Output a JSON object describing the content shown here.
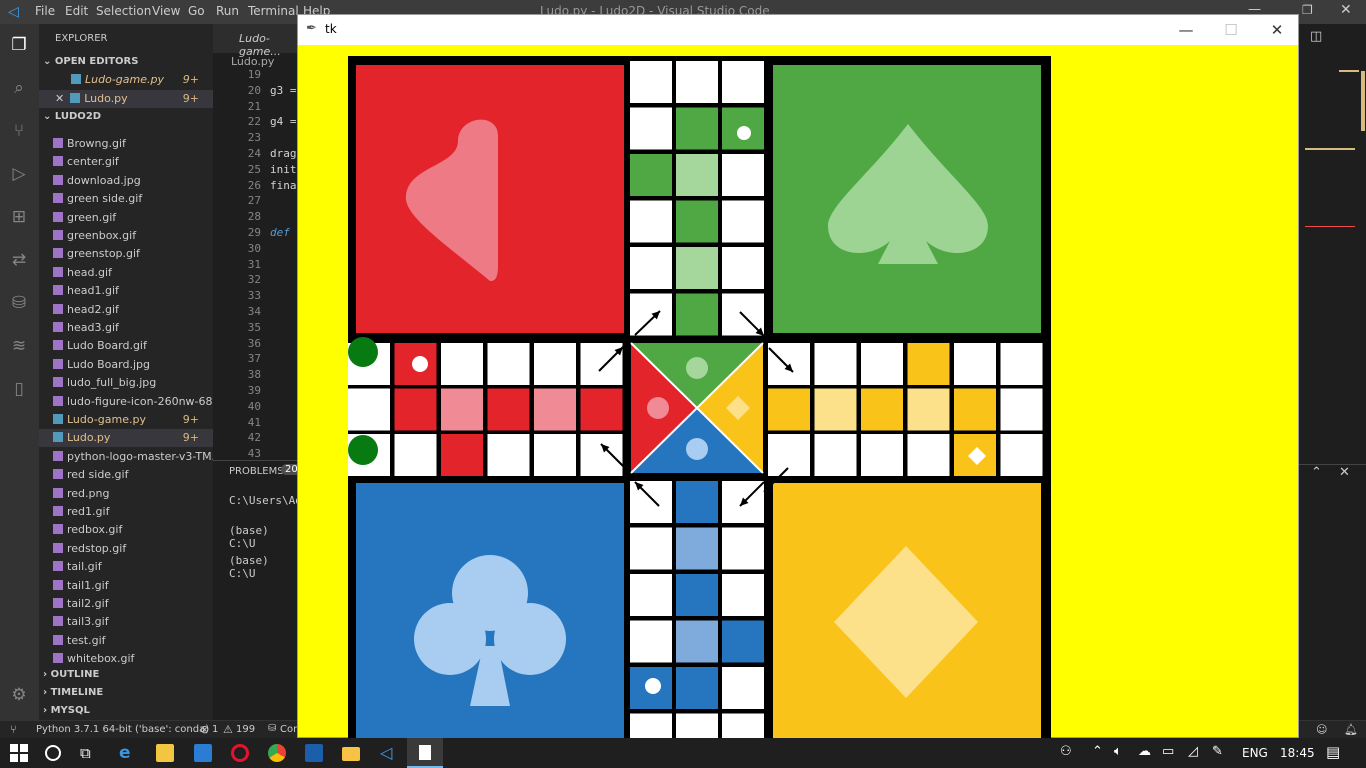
{
  "titlebar": {
    "menu": [
      "File",
      "Edit",
      "Selection",
      "View",
      "Go",
      "Run",
      "Terminal",
      "Help"
    ],
    "window_title": "Ludo.py - Ludo2D - Visual Studio Code"
  },
  "sidebar": {
    "header": "EXPLORER",
    "open_editors_label": "OPEN EDITORS",
    "open_editors": [
      {
        "name": "Ludo-game.py",
        "badge": "9+"
      },
      {
        "name": "Ludo.py",
        "badge": "9+"
      }
    ],
    "folder_label": "LUDO2D",
    "files": [
      {
        "name": "Browng.gif"
      },
      {
        "name": "center.gif"
      },
      {
        "name": "download.jpg"
      },
      {
        "name": "green side.gif"
      },
      {
        "name": "green.gif"
      },
      {
        "name": "greenbox.gif"
      },
      {
        "name": "greenstop.gif"
      },
      {
        "name": "head.gif"
      },
      {
        "name": "head1.gif"
      },
      {
        "name": "head2.gif"
      },
      {
        "name": "head3.gif"
      },
      {
        "name": "Ludo Board.gif"
      },
      {
        "name": "Ludo Board.jpg"
      },
      {
        "name": "ludo_full_big.jpg"
      },
      {
        "name": "ludo-figure-icon-260nw-687..."
      },
      {
        "name": "Ludo-game.py",
        "badge": "9+"
      },
      {
        "name": "Ludo.py",
        "badge": "9+"
      },
      {
        "name": "python-logo-master-v3-TM..."
      },
      {
        "name": "red side.gif"
      },
      {
        "name": "red.png"
      },
      {
        "name": "red1.gif"
      },
      {
        "name": "redbox.gif"
      },
      {
        "name": "redstop.gif"
      },
      {
        "name": "tail.gif"
      },
      {
        "name": "tail1.gif"
      },
      {
        "name": "tail2.gif"
      },
      {
        "name": "tail3.gif"
      },
      {
        "name": "test.gif"
      },
      {
        "name": "whitebox.gif"
      }
    ],
    "outline_label": "OUTLINE",
    "timeline_label": "TIMELINE",
    "mysql_label": "MYSQL"
  },
  "editor": {
    "tab1": "Ludo-game...",
    "breadcrumb": "Ludo.py",
    "line_numbers": [
      "19",
      "20",
      "21",
      "22",
      "23",
      "24",
      "25",
      "26",
      "27",
      "28",
      "29",
      "30",
      "31",
      "32",
      "33",
      "34",
      "35",
      "36",
      "37",
      "38",
      "39",
      "40",
      "41",
      "42",
      "43"
    ],
    "code_lines": [
      "",
      "g3 =",
      "",
      "g4 =",
      "",
      "drag",
      "init",
      "fina",
      "",
      "",
      "def",
      "",
      "",
      "",
      "",
      "",
      "",
      "",
      "",
      "",
      "",
      "",
      "",
      "",
      ""
    ]
  },
  "panel": {
    "tab": "PROBLEMS",
    "count": "20",
    "terminal_lines": [
      "C:\\Users\\Ad",
      "(base) C:\\U",
      "(base) C:\\U"
    ]
  },
  "statusbar": {
    "interpreter": "Python 3.7.1 64-bit ('base': conda)",
    "errors": "1",
    "warnings": "199",
    "extra": "Cor"
  },
  "tkwindow": {
    "title": "tk"
  },
  "taskbar": {
    "lang": "ENG",
    "time": "18:45"
  }
}
